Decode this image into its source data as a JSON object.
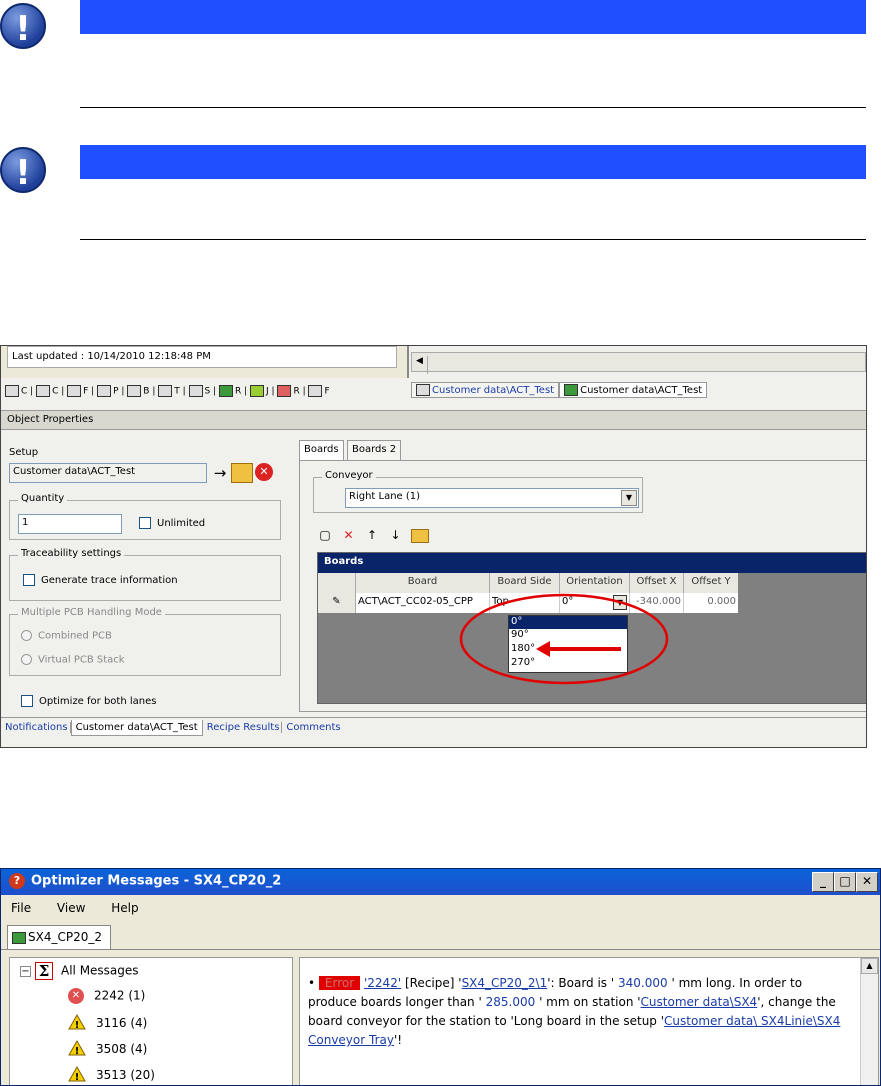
{
  "notes": [
    {},
    {}
  ],
  "setup_screenshot": {
    "last_updated": "Last updated : 10/14/2010 12:18:48 PM",
    "toolbar_letters": [
      "C",
      "C",
      "F",
      "P",
      "B",
      "T",
      "S",
      "R",
      "J",
      "R",
      "F"
    ],
    "breadcrumb_tabs": [
      "Customer data\\ACT_Test",
      "Customer data\\ACT_Test"
    ],
    "panel_title": "Object Properties",
    "setup_label": "Setup",
    "setup_value": "Customer data\\ACT_Test",
    "quantity_label": "Quantity",
    "quantity_value": "1",
    "unlimited_label": "Unlimited",
    "traceability_label": "Traceability settings",
    "generate_trace_label": "Generate trace information",
    "multi_pcb_label": "Multiple PCB Handling Mode",
    "combined_pcb_label": "Combined PCB",
    "virtual_pcb_label": "Virtual PCB Stack",
    "optimize_label": "Optimize for both lanes",
    "tabs": [
      "Boards",
      "Boards 2"
    ],
    "conveyor_label": "Conveyor",
    "conveyor_value": "Right Lane (1)",
    "grid_title": "Boards",
    "columns": [
      "Board",
      "Board Side",
      "Orientation",
      "Offset X",
      "Offset Y"
    ],
    "row": {
      "board": "ACT\\ACT_CC02-05_CPP",
      "side": "Top",
      "orientation": "0°",
      "offset_x": "-340.000",
      "offset_y": "0.000"
    },
    "orientation_options": [
      "0°",
      "90°",
      "180°",
      "270°"
    ],
    "bottom_tabs": [
      "Notifications",
      "Customer data\\ACT_Test",
      "Recipe Results",
      "Comments"
    ],
    "colors": {
      "highlight": "#e00000",
      "grid_header": "#0a246a"
    }
  },
  "messages_screenshot": {
    "title": "Optimizer Messages - SX4_CP20_2",
    "menu": [
      "File",
      "View",
      "Help"
    ],
    "tab": "SX4_CP20_2",
    "tree_root": "All Messages",
    "tree_items": [
      {
        "label": "2242 (1)",
        "kind": "error"
      },
      {
        "label": "3116 (4)",
        "kind": "warning"
      },
      {
        "label": "3508 (4)",
        "kind": "warning"
      },
      {
        "label": "3513 (20)",
        "kind": "warning"
      }
    ],
    "msg_error_badge": "Error",
    "msg_code": "'2242'",
    "msg_recipe": "[Recipe]",
    "msg_recipe_link": "SX4_CP20_2\\1",
    "msg_t1": "': Board is '",
    "msg_len": "340.000",
    "msg_t2": "' mm long. In order to produce boards longer than '",
    "msg_max": "285.000",
    "msg_t3": "' mm on station '",
    "msg_station": "Customer data\\SX4",
    "msg_t4": "', change the board conveyor for the station to 'Long board in the setup '",
    "msg_setup": "Customer data\\ SX4Linie\\SX4 Conveyor Tray",
    "msg_t5": "'!"
  }
}
